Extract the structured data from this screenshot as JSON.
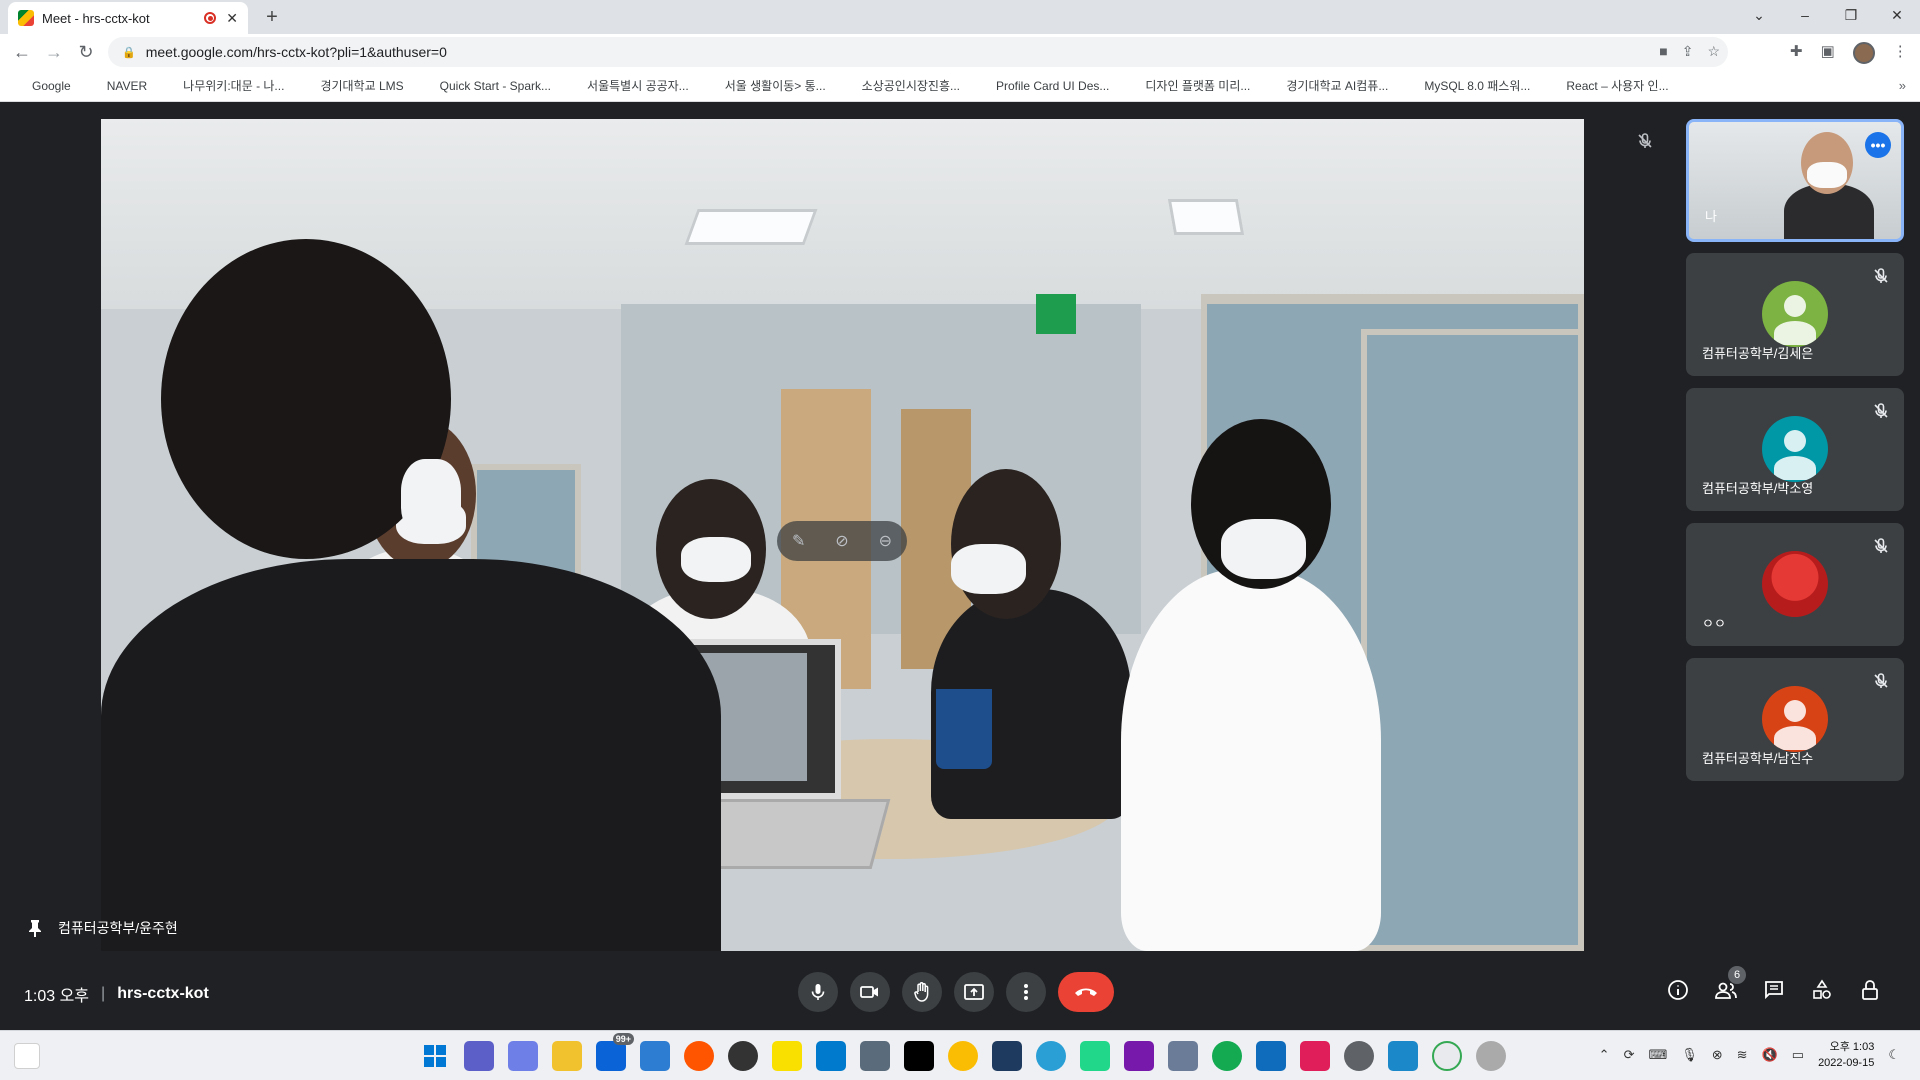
{
  "browser": {
    "tab_title": "Meet - hrs-cctx-kot",
    "tab_close": "✕",
    "new_tab": "+",
    "url": "meet.google.com/hrs-cctx-kot?pli=1&authuser=0",
    "window_controls": [
      "⌄",
      "–",
      "❐",
      "✕"
    ]
  },
  "bookmarks": [
    {
      "label": "Google",
      "color": "#4285f4"
    },
    {
      "label": "NAVER",
      "color": "#03c75a"
    },
    {
      "label": "나무위키:대문 - 나...",
      "color": "#00a495"
    },
    {
      "label": "경기대학교 LMS",
      "color": "#f4b400"
    },
    {
      "label": "Quick Start - Spark...",
      "color": "#e25a1c"
    },
    {
      "label": "서울특별시 공공자...",
      "color": "#f2a900"
    },
    {
      "label": "서울 생활이동> 통...",
      "color": "#f2a900"
    },
    {
      "label": "소상공인시장진흥...",
      "color": "#1a4ea2"
    },
    {
      "label": "Profile Card UI Des...",
      "color": "#333333"
    },
    {
      "label": "디자인 플랫폼 미리...",
      "color": "#22b573"
    },
    {
      "label": "경기대학교 AI컴퓨...",
      "color": "#444444"
    },
    {
      "label": "MySQL 8.0 패스워...",
      "color": "#555555"
    },
    {
      "label": "React – 사용자 인...",
      "color": "#20232a"
    }
  ],
  "bookmarks_more": "»",
  "main_video": {
    "speaker_name": "컴퓨터공학부/윤주현"
  },
  "participants": [
    {
      "name": "나",
      "type": "video",
      "more": "•••"
    },
    {
      "name": "컴퓨터공학부/김세은",
      "color": "#7cb342"
    },
    {
      "name": "컴퓨터공학부/박소영",
      "color": "#0097a7"
    },
    {
      "name": "ㅇㅇ",
      "color": "#b71c1c"
    },
    {
      "name": "컴퓨터공학부/남진수",
      "color": "#d84315"
    }
  ],
  "bottom_bar": {
    "time": "1:03 오후",
    "separator": "|",
    "meeting_code": "hrs-cctx-kot",
    "participants_count": "6"
  },
  "taskbar": {
    "mail_badge": "99+",
    "clock_time": "오후 1:03",
    "clock_date": "2022-09-15"
  },
  "colors": {
    "meet_background": "#202124",
    "end_call": "#ea4335",
    "accent": "#8ab4f8"
  }
}
